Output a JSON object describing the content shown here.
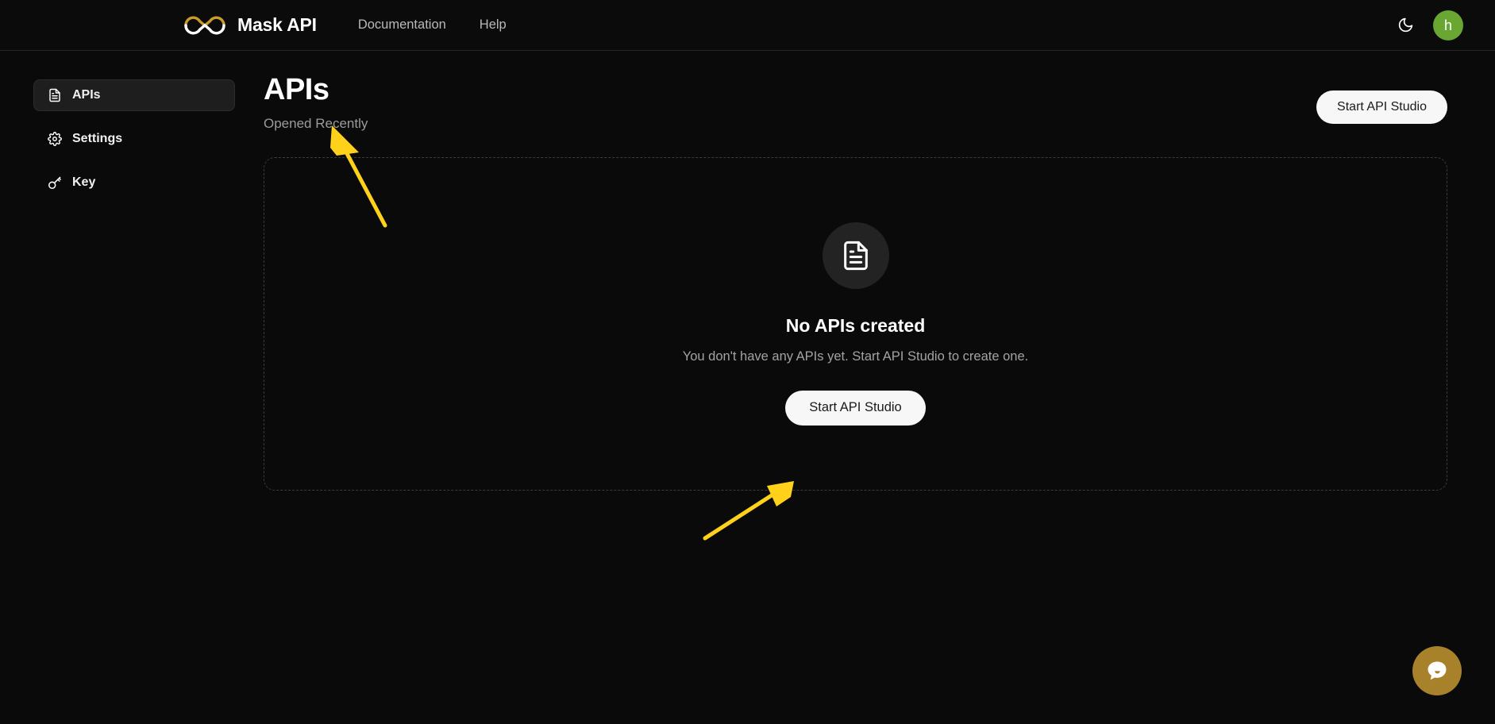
{
  "header": {
    "brand_name": "Mask API",
    "logo_icon": "infinity-logo",
    "nav": [
      {
        "label": "Documentation",
        "name": "nav-documentation"
      },
      {
        "label": "Help",
        "name": "nav-help"
      }
    ],
    "theme_toggle_icon": "moon-icon",
    "avatar_initial": "h",
    "avatar_color": "#6aa632"
  },
  "sidebar": {
    "items": [
      {
        "label": "APIs",
        "icon": "document-icon",
        "active": true
      },
      {
        "label": "Settings",
        "icon": "gear-icon",
        "active": false
      },
      {
        "label": "Key",
        "icon": "key-icon",
        "active": false
      }
    ]
  },
  "main": {
    "title": "APIs",
    "subtitle": "Opened Recently",
    "header_button_label": "Start API Studio",
    "empty_state": {
      "icon": "document-icon",
      "title": "No APIs created",
      "description": "You don't have any APIs yet. Start API Studio to create one.",
      "button_label": "Start API Studio"
    }
  },
  "chat": {
    "icon": "chat-bubble-icon",
    "color": "#a8822a"
  },
  "annotations": {
    "arrow_color": "#ffd11a",
    "arrows": [
      {
        "name": "arrow-to-apis-sidebar-item",
        "points_to": "sidebar-item-apis"
      },
      {
        "name": "arrow-to-start-api-studio-button",
        "points_to": "empty-state-start-api-studio-button"
      }
    ]
  },
  "colors": {
    "background": "#0a0a0a",
    "header_background": "#0b0b0b",
    "accent_gold": "#a8822a",
    "button_white": "#f7f7f7"
  }
}
